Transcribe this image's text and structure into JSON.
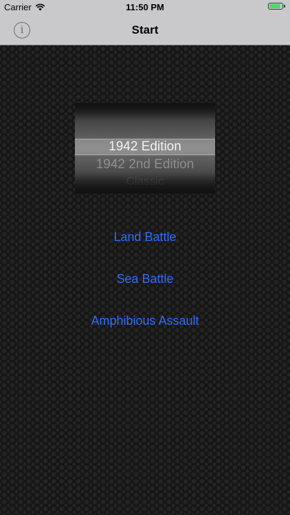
{
  "status_bar": {
    "carrier": "Carrier",
    "time": "11:50 PM",
    "battery_level_percent": 90,
    "battery_color": "#4cd964"
  },
  "nav": {
    "title": "Start",
    "info_icon": "info-icon",
    "info_glyph": "i"
  },
  "picker": {
    "options": [
      "1942 Edition",
      "1942 2nd Edition",
      "Classic"
    ],
    "selected": "1942 Edition"
  },
  "actions": {
    "land": "Land Battle",
    "sea": "Sea Battle",
    "amphibious": "Amphibious Assault"
  },
  "colors": {
    "accent": "#2f6dff",
    "nav_background": "#c9c9cb",
    "content_background": "#111111"
  }
}
